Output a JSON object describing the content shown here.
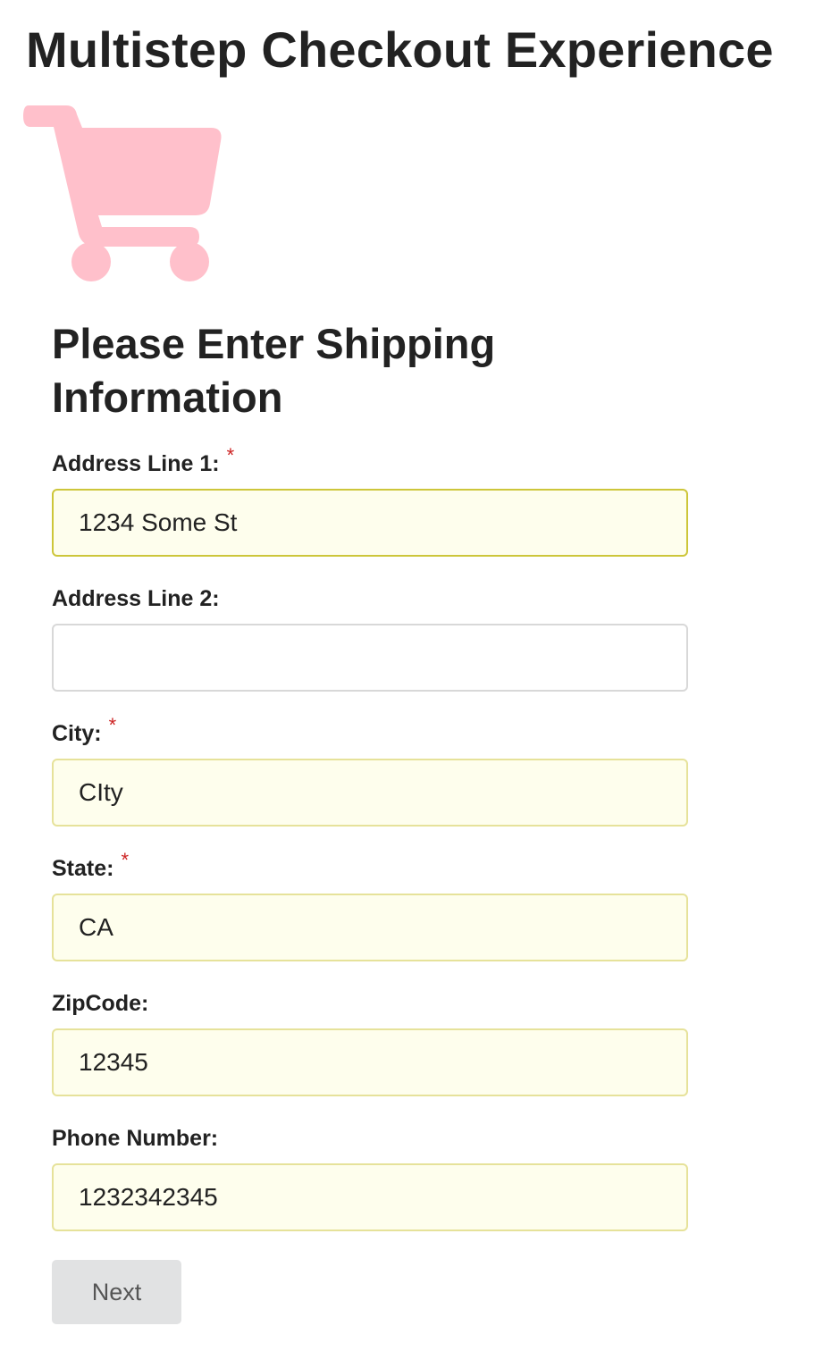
{
  "app": {
    "title": "Multistep Checkout Experience"
  },
  "icons": {
    "cart": {
      "name": "shopping-cart-icon",
      "color": "#ffc0cb"
    }
  },
  "form": {
    "heading": "Please Enter Shipping Information",
    "required_marker": "*",
    "fields": {
      "address1": {
        "label": "Address Line 1:",
        "value": "1234 Some St",
        "required": true
      },
      "address2": {
        "label": "Address Line 2:",
        "value": "",
        "required": false
      },
      "city": {
        "label": "City:",
        "value": "CIty",
        "required": true
      },
      "state": {
        "label": "State:",
        "value": "CA",
        "required": true
      },
      "zipcode": {
        "label": "ZipCode:",
        "value": "12345",
        "required": false
      },
      "phone": {
        "label": "Phone Number:",
        "value": "1232342345",
        "required": false
      }
    },
    "next_label": "Next"
  },
  "colors": {
    "required_asterisk": "#cc2222",
    "input_fill": "#fefeed",
    "input_border": "#e6e29a",
    "button_fill": "#e1e2e3"
  }
}
